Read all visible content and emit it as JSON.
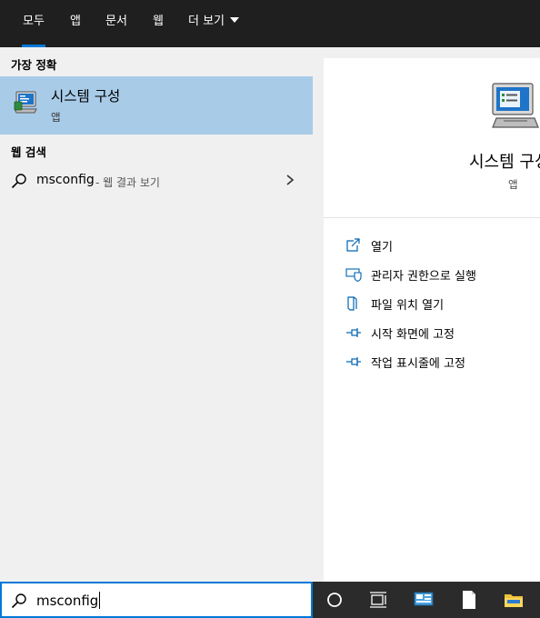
{
  "tabs": [
    {
      "label": "모두",
      "active": true
    },
    {
      "label": "앱",
      "active": false
    },
    {
      "label": "문서",
      "active": false
    },
    {
      "label": "웹",
      "active": false
    },
    {
      "label": "더 보기",
      "active": false
    }
  ],
  "best_match": {
    "header": "가장 정확",
    "title": "시스템 구성",
    "subtitle": "앱",
    "icon": "system-configuration-icon"
  },
  "web_search": {
    "header": "웹 검색",
    "query": "msconfig",
    "suffix": "- 웹 결과 보기"
  },
  "detail": {
    "title": "시스템 구성",
    "subtitle": "앱",
    "actions": [
      {
        "label": "열기",
        "icon": "open-icon"
      },
      {
        "label": "관리자 권한으로 실행",
        "icon": "shield-icon"
      },
      {
        "label": "파일 위치 열기",
        "icon": "file-location-icon"
      },
      {
        "label": "시작 화면에 고정",
        "icon": "pin-icon"
      },
      {
        "label": "작업 표시줄에 고정",
        "icon": "pin-icon"
      }
    ]
  },
  "search_box": {
    "value": "msconfig"
  },
  "taskbar_icons": [
    "cortana-icon",
    "task-view-icon",
    "control-panel-icon",
    "document-icon",
    "file-explorer-icon"
  ],
  "colors": {
    "accent": "#0078d7",
    "highlight": "#a8cbe8",
    "topbar": "#1f1f1f",
    "taskbar": "#2b2b2b"
  }
}
